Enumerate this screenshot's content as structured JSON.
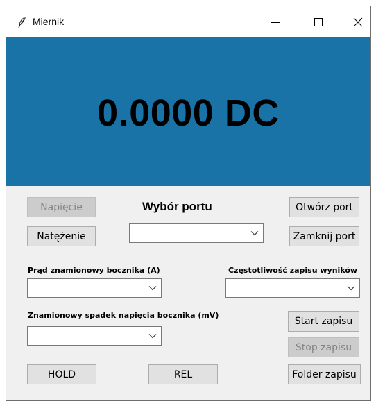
{
  "window": {
    "title": "Miernik",
    "icon": "feather-icon"
  },
  "display": {
    "value": "0.0000 DC",
    "background": "#1a73a6"
  },
  "mode_buttons": {
    "voltage": "Napięcie",
    "current": "Natężenie"
  },
  "port": {
    "heading": "Wybór portu",
    "selected": "",
    "open": "Otwórz port",
    "close": "Zamknij port"
  },
  "shunt": {
    "current_label": "Prąd znamionowy bocznika (A)",
    "current_value": "",
    "voltage_drop_label": "Znamionowy spadek napięcia bocznika (mV)",
    "voltage_drop_value": ""
  },
  "recording": {
    "frequency_label": "Częstotliwość zapisu wyników",
    "frequency_value": "",
    "start": "Start zapisu",
    "stop": "Stop zapisu",
    "folder": "Folder zapisu"
  },
  "controls": {
    "hold": "HOLD",
    "rel": "REL"
  }
}
